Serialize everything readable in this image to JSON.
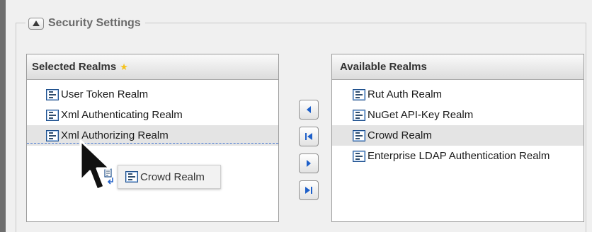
{
  "section": {
    "title": "Security Settings",
    "collapse_icon": "triangle-up-icon"
  },
  "selected": {
    "header": "Selected Realms",
    "header_icon": "star-icon",
    "items": [
      {
        "label": "User Token Realm"
      },
      {
        "label": "Xml Authenticating Realm"
      },
      {
        "label": "Xml Authorizing Realm"
      }
    ]
  },
  "available": {
    "header": "Available Realms",
    "items": [
      {
        "label": "Rut Auth Realm"
      },
      {
        "label": "NuGet API-Key Realm"
      },
      {
        "label": "Crowd Realm",
        "highlighted": true
      },
      {
        "label": "Enterprise LDAP Authentication Realm"
      }
    ]
  },
  "drag": {
    "label": "Crowd Realm"
  },
  "move_buttons": [
    "move-left-icon",
    "move-all-left-icon",
    "move-right-icon",
    "move-all-right-icon"
  ],
  "colors": {
    "accent_blue": "#1d5fc9",
    "star": "#f5c21b",
    "drop_line": "#4a7ad1"
  }
}
